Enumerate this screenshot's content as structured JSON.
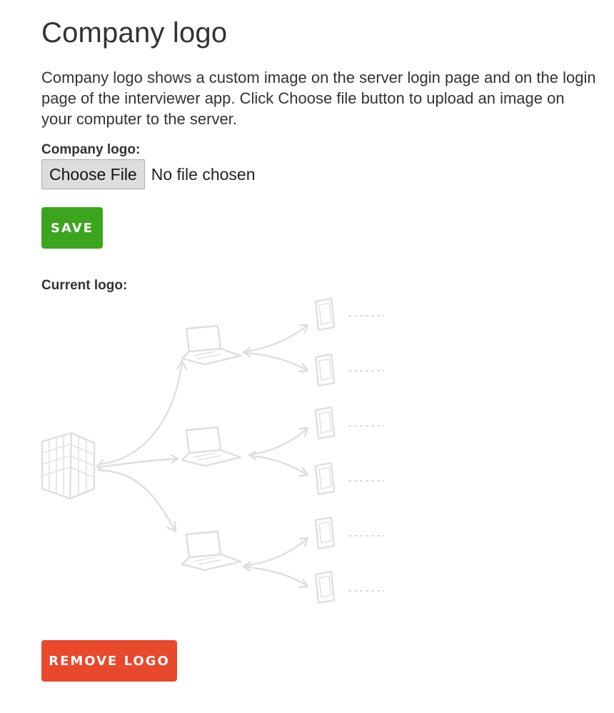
{
  "page": {
    "title": "Company logo",
    "description": "Company logo shows a custom image on the server login page and on the login page of the interviewer app. Click Choose file button to upload an image on your computer to the server."
  },
  "upload": {
    "label": "Company logo:",
    "choose_button_label": "Choose File",
    "file_status": "No file chosen"
  },
  "actions": {
    "save_label": "SAVE",
    "remove_label": "REMOVE LOGO"
  },
  "current": {
    "label": "Current logo:",
    "image_icon": "server-laptops-phones-diagram"
  },
  "colors": {
    "save": "#3aa51d",
    "remove": "#e8482b",
    "text": "#333333",
    "illustration": "#dedede"
  }
}
